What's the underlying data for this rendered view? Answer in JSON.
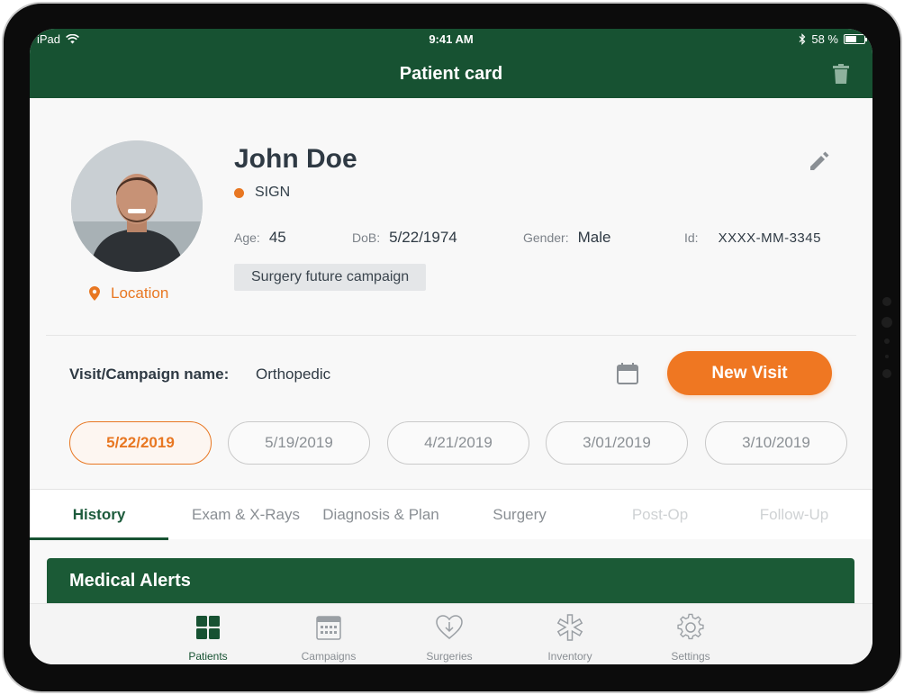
{
  "status_bar": {
    "device": "iPad",
    "time": "9:41 AM",
    "battery": "58 %",
    "battery_level": 0.58
  },
  "header": {
    "title": "Patient card"
  },
  "patient": {
    "name": "John Doe",
    "status": "SIGN",
    "location": "Location",
    "age_label": "Age:",
    "age": "45",
    "dob_label": "DoB:",
    "dob": "5/22/1974",
    "gender_label": "Gender:",
    "gender": "Male",
    "id_label": "Id:",
    "id": "XXXX-MM-3345",
    "campaign_tag": "Surgery future campaign"
  },
  "visit": {
    "label": "Visit/Campaign name:",
    "value": "Orthopedic",
    "new_visit_button": "New Visit"
  },
  "dates": [
    "5/22/2019",
    "5/19/2019",
    "4/21/2019",
    "3/01/2019",
    "3/10/2019"
  ],
  "tabs": [
    "History",
    "Exam & X-Rays",
    "Diagnosis & Plan",
    "Surgery",
    "Post-Op",
    "Follow-Up"
  ],
  "section": {
    "medical_alerts": "Medical Alerts"
  },
  "bottom_nav": [
    "Patients",
    "Campaigns",
    "Surgeries",
    "Inventory",
    "Settings"
  ],
  "colors": {
    "primary_green": "#175232",
    "accent_orange": "#ef7722"
  },
  "icons": [
    "wifi-icon",
    "bluetooth-icon",
    "battery-icon",
    "trash-icon",
    "edit-icon",
    "location-pin-icon",
    "calendar-icon",
    "patients-grid-icon",
    "campaigns-calendar-icon",
    "surgeries-heart-icon",
    "inventory-asterisk-icon",
    "settings-gear-icon"
  ]
}
